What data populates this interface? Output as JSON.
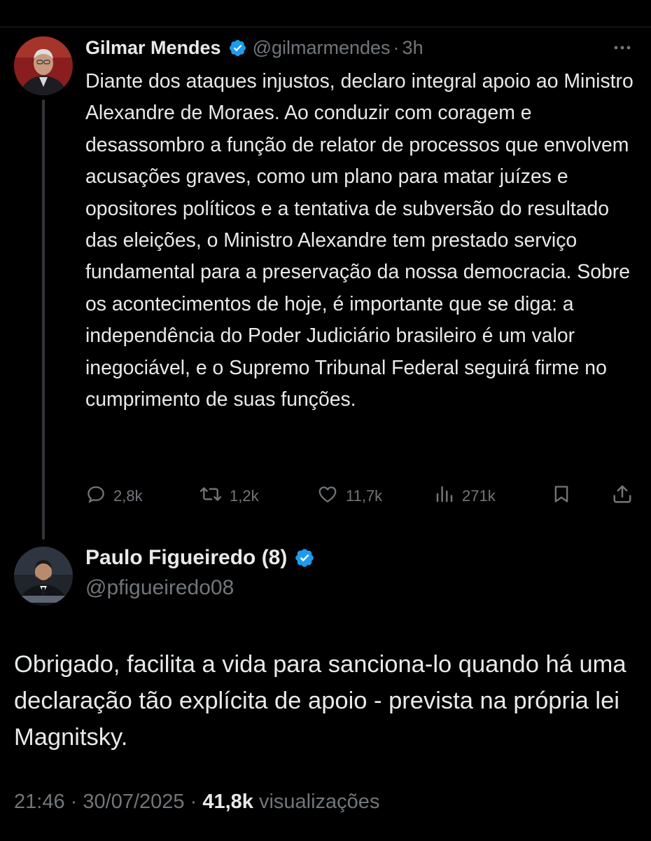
{
  "parent_tweet": {
    "author_name": "Gilmar Mendes",
    "handle": "@gilmarmendes",
    "separator": "·",
    "time": "3h",
    "text": "Diante dos ataques injustos, declaro integral apoio ao Ministro Alexandre de Moraes. Ao conduzir com coragem e desassombro a função de relator de processos que envolvem acusações graves, como um plano para matar juízes e opositores políticos e a tentativa de subversão do resultado das eleições, o Ministro Alexandre tem prestado serviço fundamental para a preservação da nossa democracia. Sobre os acontecimentos de hoje, é importante que se diga: a independência do Poder Judiciário brasileiro é um valor inegociável, e o Supremo Tribunal Federal seguirá firme no cumprimento de suas funções.",
    "stats": {
      "replies": "2,8k",
      "retweets": "1,2k",
      "likes": "11,7k",
      "views": "271k"
    }
  },
  "reply_tweet": {
    "author_name": "Paulo Figueiredo (8)",
    "handle": "@pfigueiredo08",
    "text": "Obrigado, facilita a vida para sanciona-lo quando há uma declaração tão explícita de apoio - prevista na própria lei Magnitsky.",
    "time": "21:46",
    "separator": "·",
    "date": "30/07/2025",
    "views_count": "41,8k",
    "views_label": "visualizações"
  },
  "icons": {
    "verified": "verified-badge-icon",
    "more": "more-icon",
    "reply": "reply-icon",
    "retweet": "retweet-icon",
    "like": "heart-icon",
    "views": "views-icon",
    "bookmark": "bookmark-icon",
    "share": "share-icon"
  },
  "colors": {
    "background": "#000000",
    "text": "#e7e9ea",
    "muted": "#71767b",
    "verified": "#1d9bf0",
    "thread_line": "#333639"
  }
}
